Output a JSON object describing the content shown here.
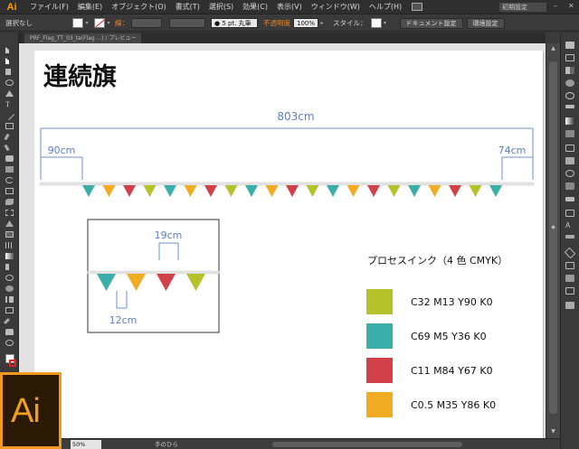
{
  "app": {
    "badge": "Ai",
    "menus": [
      "ファイル(F)",
      "編集(E)",
      "オブジェクト(O)",
      "書式(T)",
      "選択(S)",
      "効果(C)",
      "表示(V)",
      "ウィンドウ(W)",
      "ヘルプ(H)"
    ],
    "workspace": "初期設定",
    "minimize": "–",
    "close": "✕",
    "layout_icon": "layout-icon"
  },
  "control_bar": {
    "selection": "選択なし",
    "stroke_label": "線：",
    "brush": "● 5 pt. 丸筆",
    "opacity_label": "不透明度",
    "opacity_value": "100%",
    "style_label": "スタイル：",
    "doc_setup": "ドキュメント設定",
    "prefs": "環境設定"
  },
  "tab": {
    "label": "PRF_Flag_TT_03_ta(Flag ...) / プレビュー"
  },
  "status_bar": {
    "zoom": "50%",
    "tool": "手のひら"
  },
  "artboard": {
    "title": "連続旗",
    "total_width": "803cm",
    "left_margin": "90cm",
    "right_margin": "74cm",
    "detail_spacing": "19cm",
    "detail_flag_width": "12cm",
    "legend_title": "プロセスインク（4 色 CMYK）",
    "legend": [
      {
        "label": "C32 M13 Y90 K0",
        "color": "#b5c22c"
      },
      {
        "label": "C69 M5 Y36 K0",
        "color": "#3aafa9"
      },
      {
        "label": "C11 M84 Y67 K0",
        "color": "#d2404a"
      },
      {
        "label": "C0.5 M35 Y86 K0",
        "color": "#f0ac23"
      }
    ]
  },
  "colors": {
    "dimension_blue": "#5b7fc2",
    "flag_sequence": [
      "#3aafa9",
      "#f0ac23",
      "#d2404a",
      "#b5c22c"
    ],
    "ai_orange": "#f39c22"
  },
  "logo": {
    "text": "Ai"
  }
}
